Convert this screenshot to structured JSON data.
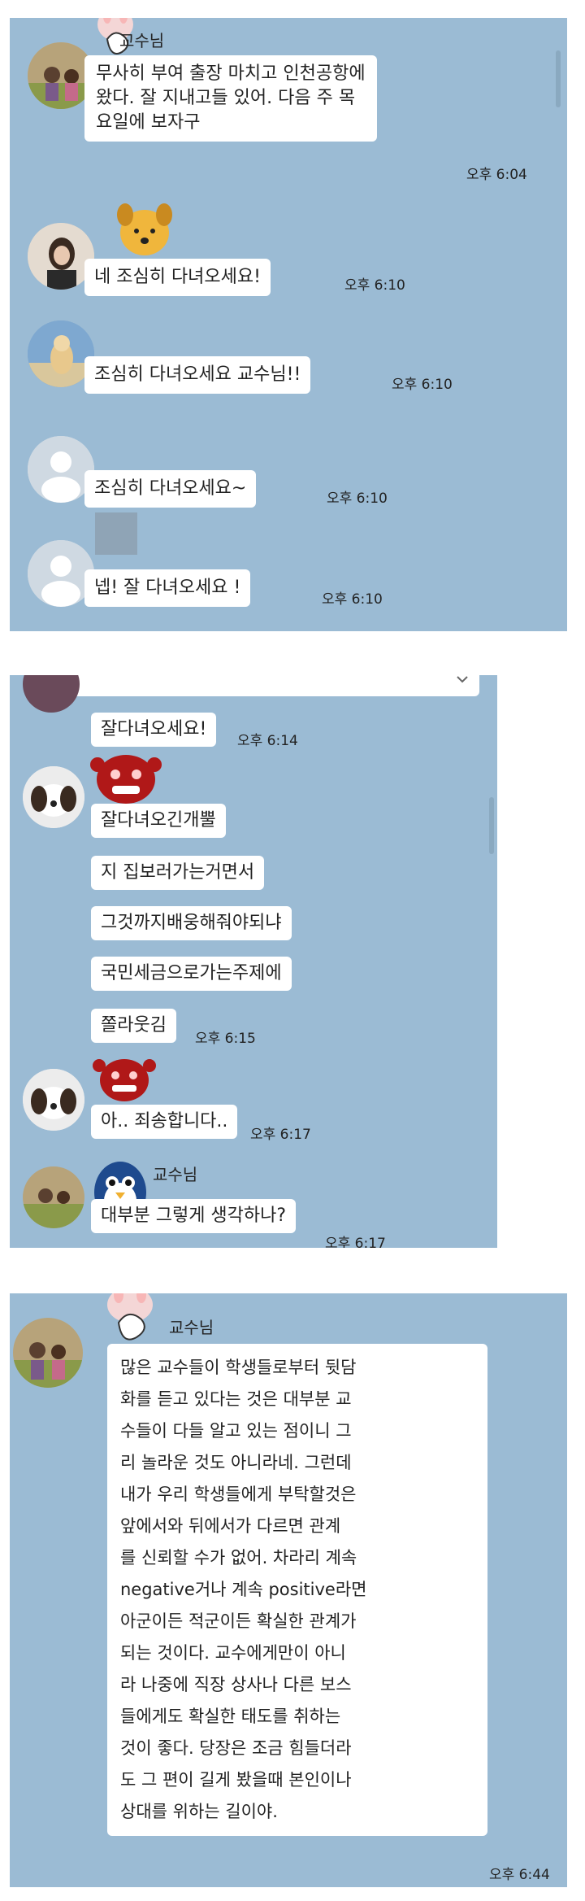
{
  "colors": {
    "chat_bg": "#9bbbd4",
    "bubble": "#ffffff",
    "ghost_avatar": "#dfe6ec"
  },
  "panel1": {
    "messages": [
      {
        "sender": "교수님",
        "text": "무사히 부여 출장 마치고 인천공항에 왔다. 잘 지내고들 있어. 다음 주 목요일에 보자구",
        "time": "오후 6:04",
        "sticker": "bunny-sticker"
      },
      {
        "text": "네 조심히 다녀오세요!",
        "time": "오후 6:10",
        "sticker": "dog-sticker"
      },
      {
        "text": "조심히 다녀오세요 교수님!!",
        "time": "오후 6:10"
      },
      {
        "text": "조심히 다녀오세요~",
        "time": "오후 6:10"
      },
      {
        "text": "넵! 잘 다녀오세요 !",
        "time": "오후 6:10"
      }
    ]
  },
  "panel2": {
    "messages": [
      {
        "text": "잘다녀오세요!",
        "time": "오후 6:14"
      },
      {
        "text": "잘다녀오긴개뿔",
        "sticker": "red-monster-sticker"
      },
      {
        "text": "지 집보러가는거면서"
      },
      {
        "text": "그것까지배웅해줘야되냐"
      },
      {
        "text": "국민세금으로가는주제에"
      },
      {
        "text": "쫄라웃김",
        "time": "오후 6:15"
      },
      {
        "text": "아.. 죄송합니다..",
        "time": "오후 6:17",
        "sticker": "red-monster-sticker"
      },
      {
        "sender": "교수님",
        "text": "대부분 그렇게 생각하나?",
        "time": "오후 6:17",
        "sticker": "penguin-sticker"
      }
    ]
  },
  "panel3": {
    "messages": [
      {
        "sender": "교수님",
        "lines": [
          "많은 교수들이 학생들로부터 뒷담",
          "화를 듣고 있다는 것은 대부분 교",
          "수들이 다들 알고 있는 점이니 그",
          "리 놀라운 것도 아니라네. 그런데",
          "내가 우리 학생들에게 부탁할것은",
          "앞에서와 뒤에서가 다르면 관계",
          "를 신뢰할 수가 없어. 차라리 계속",
          "negative거나 계속 positive라면",
          "아군이든 적군이든 확실한 관계가",
          "되는 것이다. 교수에게만이 아니",
          "라 나중에 직장 상사나 다른 보스",
          "들에게도 확실한 태도를 취하는",
          "것이 좋다. 당장은 조금 힘들더라",
          "도 그 편이 길게 봤을때 본인이나",
          "상대를 위하는 길이야."
        ],
        "time": "오후 6:44",
        "sticker": "bunny-sticker"
      }
    ]
  }
}
